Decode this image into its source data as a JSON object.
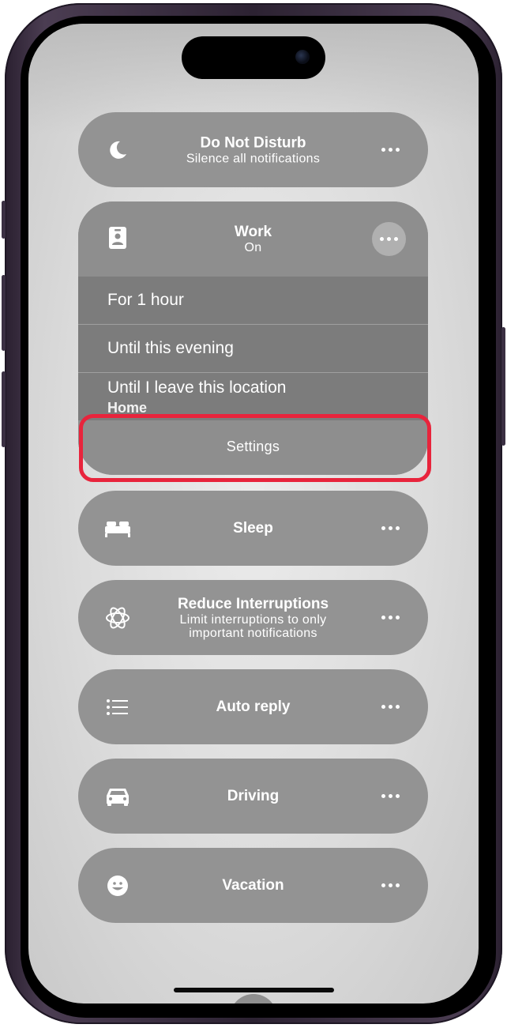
{
  "focus": {
    "do_not_disturb": {
      "title": "Do Not Disturb",
      "subtitle": "Silence all notifications"
    },
    "work": {
      "title": "Work",
      "status": "On",
      "options": [
        {
          "label": "For 1 hour"
        },
        {
          "label": "Until this evening"
        },
        {
          "label": "Until I leave this location",
          "sub": "Home"
        }
      ],
      "settings_label": "Settings"
    },
    "sleep": {
      "title": "Sleep"
    },
    "reduce": {
      "title": "Reduce Interruptions",
      "subtitle_line1": "Limit interruptions to only",
      "subtitle_line2": "important notifications"
    },
    "auto_reply": {
      "title": "Auto reply"
    },
    "driving": {
      "title": "Driving"
    },
    "vacation": {
      "title": "Vacation"
    }
  },
  "icons": {
    "do_not_disturb": "moon-icon",
    "work": "id-badge-icon",
    "sleep": "bed-icon",
    "reduce": "atom-icon",
    "auto_reply": "list-icon",
    "driving": "car-icon",
    "vacation": "smiley-icon",
    "more": "ellipsis-icon"
  },
  "colors": {
    "highlight": "#e8243c",
    "pill": "#939393",
    "work_card": "#8d8d8d",
    "option_row": "#7c7c7c",
    "frame": "#3b2f42"
  }
}
